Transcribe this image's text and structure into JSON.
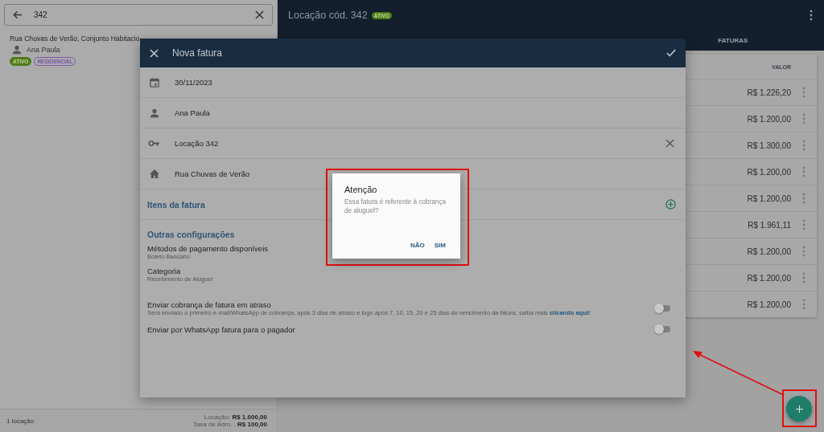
{
  "search": {
    "value": "342"
  },
  "results": [
    {
      "address": "Rua Chuvas de Verão, Conjunto Habitacio",
      "tenant": "Ana Paula",
      "tags": [
        {
          "label": "ATIVO",
          "kind": "filled",
          "color": "#4d7c16"
        },
        {
          "label": "RESIDENCIAL",
          "kind": "outlined",
          "color": "#7b55a8"
        }
      ]
    }
  ],
  "footer": {
    "count": "1 locação",
    "lines": [
      {
        "label": "Locação:",
        "value": "R$ 1.000,00"
      },
      {
        "label": "Taxa de Adm. :",
        "value": "R$ 100,00"
      }
    ]
  },
  "header": {
    "title": "Locação cód. 342",
    "status": "ATIVO"
  },
  "tabs": [
    {
      "label": "FATURAS"
    }
  ],
  "table": {
    "columns": [
      "VALOR"
    ],
    "rows": [
      {
        "value": "R$ 1.226,20"
      },
      {
        "value": "R$ 1.200,00"
      },
      {
        "value": "R$ 1.300,00"
      },
      {
        "value": "R$ 1.200,00"
      },
      {
        "value": "R$ 1.200,00"
      },
      {
        "value": "R$ 1.961,11"
      },
      {
        "value": "R$ 1.200,00"
      },
      {
        "value": "R$ 1.200,00"
      },
      {
        "value": "R$ 1.200,00"
      }
    ]
  },
  "modal": {
    "title": "Nova fatura",
    "fields": [
      {
        "kind": "date",
        "value": "30/11/2023",
        "clearable": false
      },
      {
        "kind": "person",
        "value": "Ana Paula",
        "clearable": false
      },
      {
        "kind": "key",
        "value": "Locação 342",
        "clearable": true
      },
      {
        "kind": "home",
        "value": "Rua Chuvas de Verão",
        "clearable": false
      }
    ],
    "items_title": "Itens da fatura",
    "settings_title": "Outras configurações",
    "settings": [
      {
        "label": "Métodos de pagamento disponíveis",
        "value": "Boleto Bancário"
      },
      {
        "label": "Categoria",
        "value": "Recebimento de Aluguel"
      }
    ],
    "toggles": [
      {
        "label": "Enviar cobrança de fatura em atraso",
        "hint": "Será enviado o primeiro e-mail/WhatsApp de cobrança, após 3 dias de atraso e logo após 7, 10, 15, 20 e 25 dias do vencimento da fatura, saiba mais",
        "link": "clicando aqui!",
        "on": false
      },
      {
        "label": "Enviar por WhatsApp fatura para o pagador",
        "on": false
      }
    ]
  },
  "dialog": {
    "title": "Atenção",
    "message": "Essa fatura é referente à cobrança de aluguel?",
    "buttons": [
      "NÃO",
      "SIM"
    ]
  }
}
